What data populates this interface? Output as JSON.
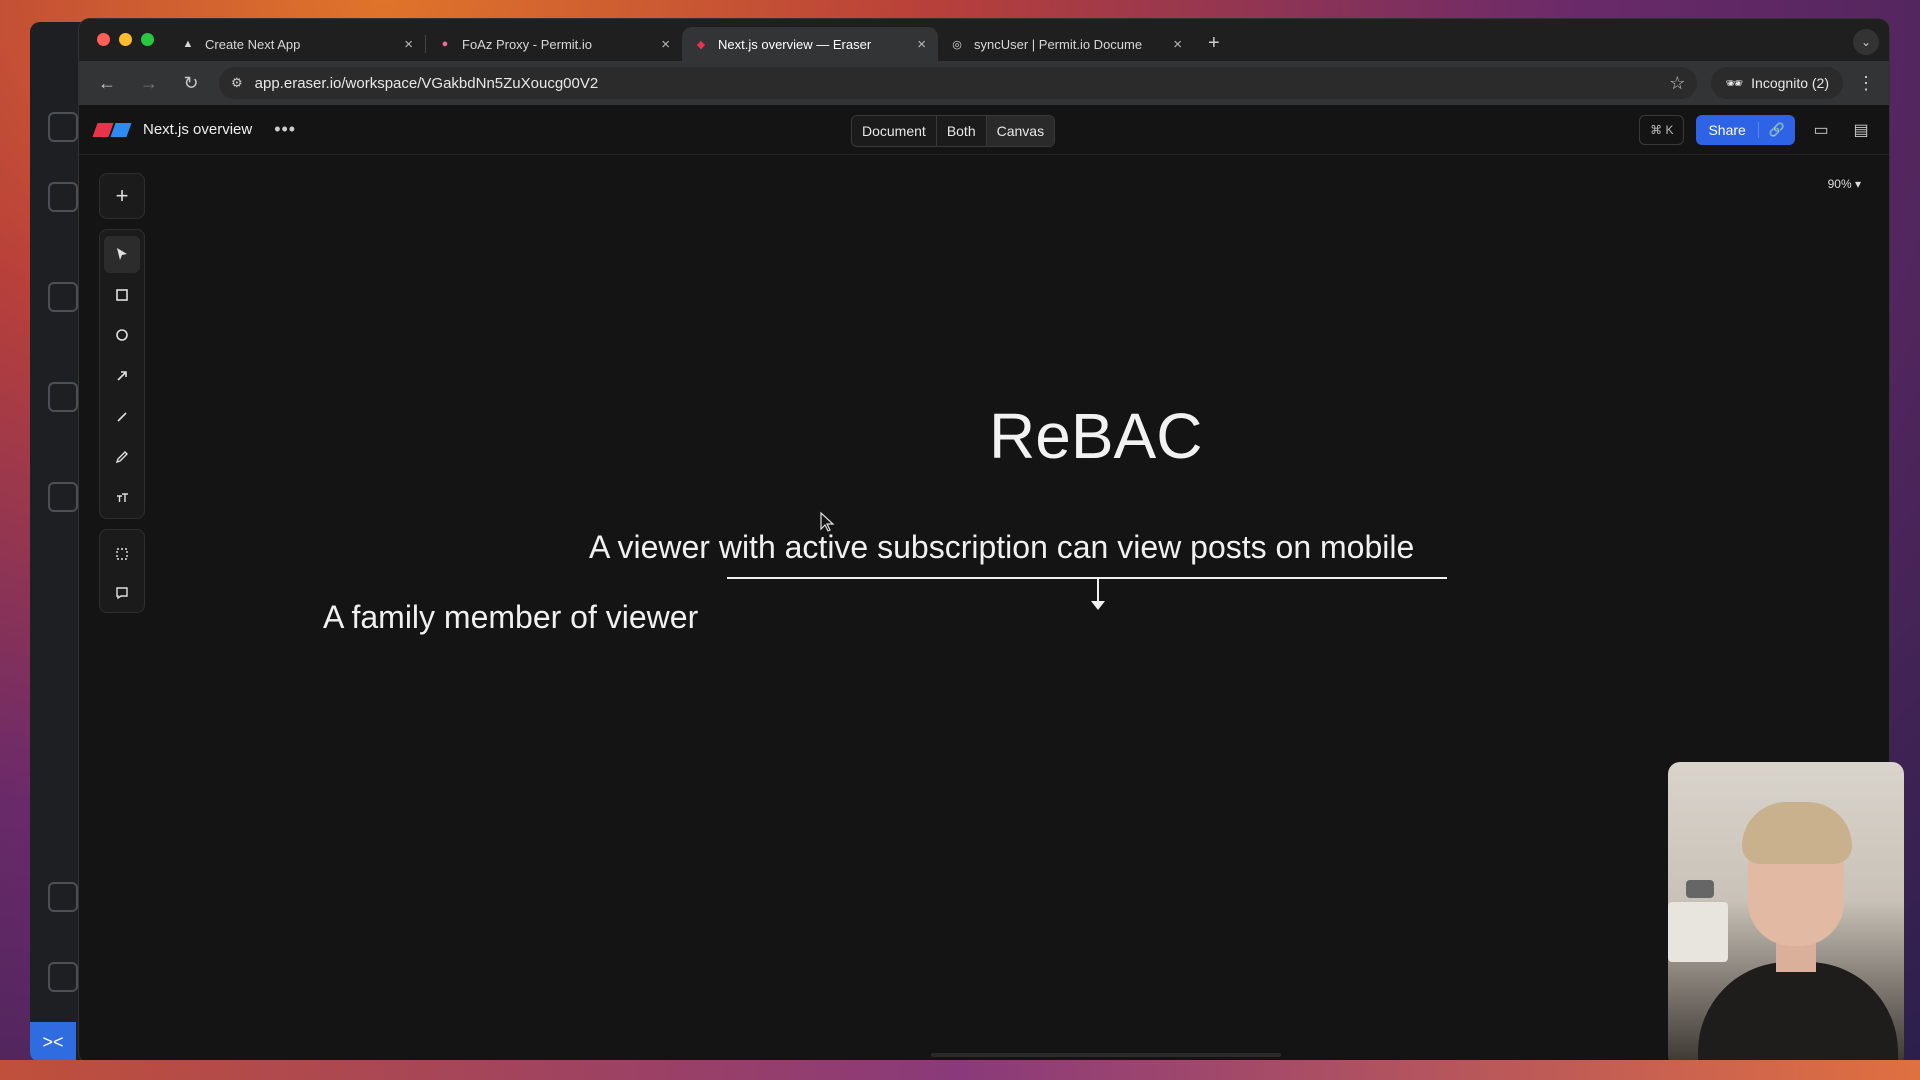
{
  "browser": {
    "tabs": [
      {
        "title": "Create Next App",
        "icon": "triangle-icon",
        "active": false
      },
      {
        "title": "FoAz Proxy - Permit.io",
        "icon": "permit-icon",
        "active": false
      },
      {
        "title": "Next.js overview — Eraser",
        "icon": "eraser-icon",
        "active": true
      },
      {
        "title": "syncUser | Permit.io Docume",
        "icon": "permit-docs-icon",
        "active": false
      }
    ],
    "url": "app.eraser.io/workspace/VGakbdNn5ZuXoucg00V2",
    "incognito_label": "Incognito (2)"
  },
  "app": {
    "doc_title": "Next.js overview",
    "view_modes": [
      "Document",
      "Both",
      "Canvas"
    ],
    "active_view": "Canvas",
    "shortcut": "⌘ K",
    "share_label": "Share",
    "zoom": "90%"
  },
  "canvas": {
    "title": "ReBAC",
    "line1": "A viewer with active subscription can view posts on mobile",
    "line2": "A family member of viewer"
  },
  "colors": {
    "accent": "#2e63e6",
    "canvas_bg": "#141414"
  }
}
